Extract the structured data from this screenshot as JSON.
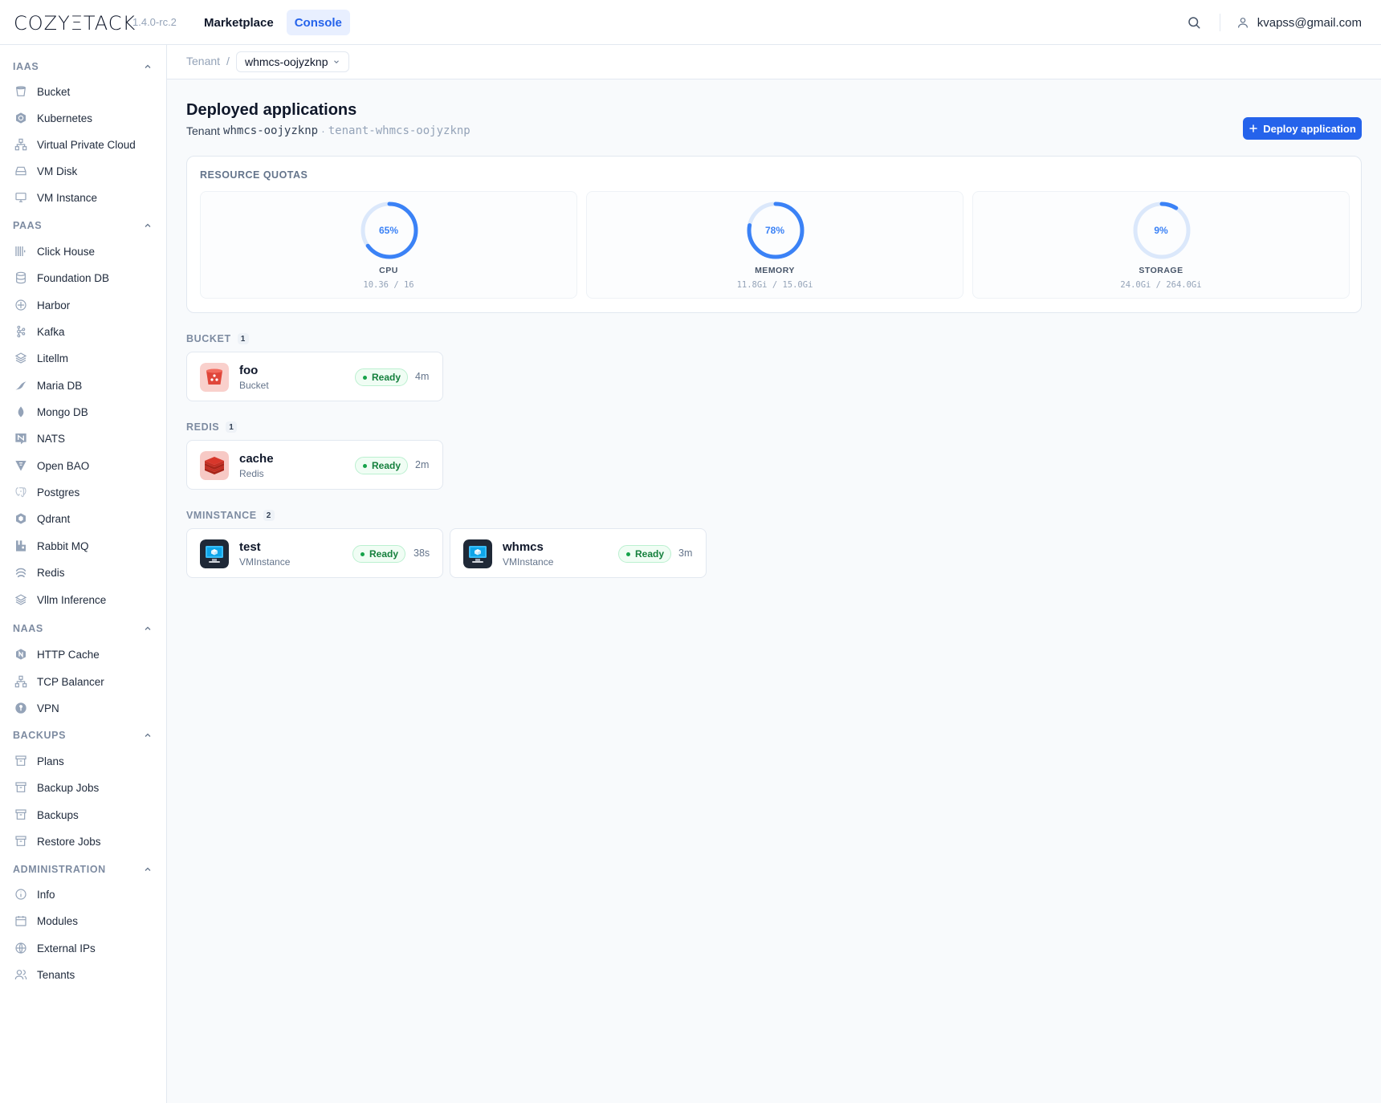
{
  "brand": {
    "logo": "COZYΞTACK",
    "version": "1.4.0-rc.2"
  },
  "topnav": {
    "marketplace": "Marketplace",
    "console": "Console"
  },
  "user": {
    "email": "kvapss@gmail.com"
  },
  "sidebar": {
    "iaas": {
      "title": "IAAS",
      "items": [
        "Bucket",
        "Kubernetes",
        "Virtual Private Cloud",
        "VM Disk",
        "VM Instance"
      ]
    },
    "paas": {
      "title": "PAAS",
      "items": [
        "Click House",
        "Foundation DB",
        "Harbor",
        "Kafka",
        "Litellm",
        "Maria DB",
        "Mongo DB",
        "NATS",
        "Open BAO",
        "Postgres",
        "Qdrant",
        "Rabbit MQ",
        "Redis",
        "Vllm Inference"
      ]
    },
    "naas": {
      "title": "NAAS",
      "items": [
        "HTTP Cache",
        "TCP Balancer",
        "VPN"
      ]
    },
    "backups": {
      "title": "BACKUPS",
      "items": [
        "Plans",
        "Backup Jobs",
        "Backups",
        "Restore Jobs"
      ]
    },
    "administration": {
      "title": "ADMINISTRATION",
      "items": [
        "Info",
        "Modules",
        "External IPs",
        "Tenants"
      ]
    }
  },
  "breadcrumb": {
    "root": "Tenant",
    "separator": "/",
    "current": "whmcs-oojyzknp"
  },
  "page": {
    "title": "Deployed applications",
    "tenant_label": "Tenant",
    "tenant_name": "whmcs-oojyzknp",
    "dot": "·",
    "namespace": "tenant-whmcs-oojyzknp",
    "deploy_label": "Deploy application"
  },
  "quotas": {
    "title": "RESOURCE QUOTAS",
    "items": [
      {
        "label": "CPU",
        "percent": 65,
        "percent_text": "65%",
        "value": "10.36 / 16"
      },
      {
        "label": "MEMORY",
        "percent": 78,
        "percent_text": "78%",
        "value": "11.8Gi / 15.0Gi"
      },
      {
        "label": "STORAGE",
        "percent": 9,
        "percent_text": "9%",
        "value": "24.0Gi / 264.0Gi"
      }
    ],
    "accent": "#3b82f6",
    "track": "#dbe8fb"
  },
  "sections": {
    "bucket": {
      "title": "BUCKET",
      "count": "1",
      "apps": [
        {
          "name": "foo",
          "kind": "Bucket",
          "status": "Ready",
          "age": "4m"
        }
      ]
    },
    "redis": {
      "title": "REDIS",
      "count": "1",
      "apps": [
        {
          "name": "cache",
          "kind": "Redis",
          "status": "Ready",
          "age": "2m"
        }
      ]
    },
    "vminstance": {
      "title": "VMINSTANCE",
      "count": "2",
      "apps": [
        {
          "name": "test",
          "kind": "VMInstance",
          "status": "Ready",
          "age": "38s"
        },
        {
          "name": "whmcs",
          "kind": "VMInstance",
          "status": "Ready",
          "age": "3m"
        }
      ]
    }
  }
}
